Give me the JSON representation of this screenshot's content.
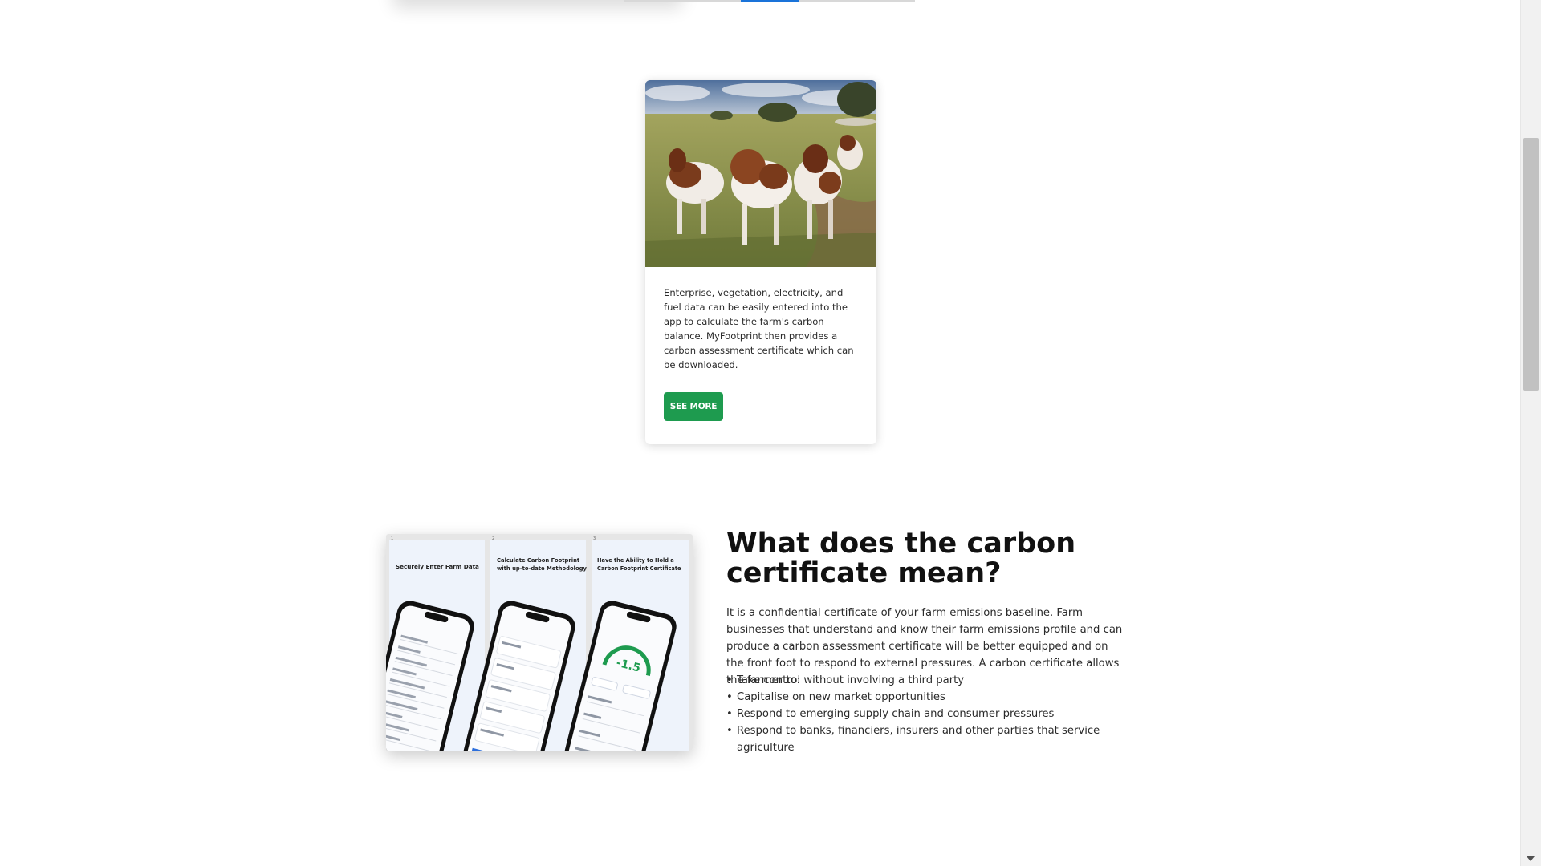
{
  "card": {
    "photo_icon": "goats-photo",
    "description": "Enterprise, vegetation, electricity, and fuel data can be easily entered into the app to calculate the farm's carbon balance. MyFootprint then provides a carbon assessment certificate which can be downloaded.",
    "button_label": "SEE MORE",
    "button_color": "#1e9b4f"
  },
  "screenshots": {
    "panels": [
      {
        "number": "1",
        "title_line1": "Securely Enter Farm Data",
        "title_line2": ""
      },
      {
        "number": "2",
        "title_line1": "Calculate Carbon Footprint",
        "title_line2": "with up-to-date Methodology"
      },
      {
        "number": "3",
        "title_line1": "Have the Ability to Hold a",
        "title_line2": "Carbon Footprint Certificate"
      }
    ],
    "score_value": "-1.5"
  },
  "section": {
    "title": "What does the carbon certificate mean?",
    "paragraph": "It is a confidential certificate of your farm emissions baseline. Farm businesses that understand and know their farm emissions profile and can produce a carbon assessment certificate will be better equipped and on the front foot to respond to external pressures. A carbon certificate allows the farmer to:",
    "bullets": [
      "Take control without involving a third party",
      "Capitalise on new market opportunities",
      "Respond to emerging supply chain and consumer pressures",
      "Respond to banks, financiers, insurers and other parties that service agriculture"
    ]
  },
  "colors": {
    "accent_green": "#1e9b4f",
    "tab_blue": "#1a73d9"
  }
}
